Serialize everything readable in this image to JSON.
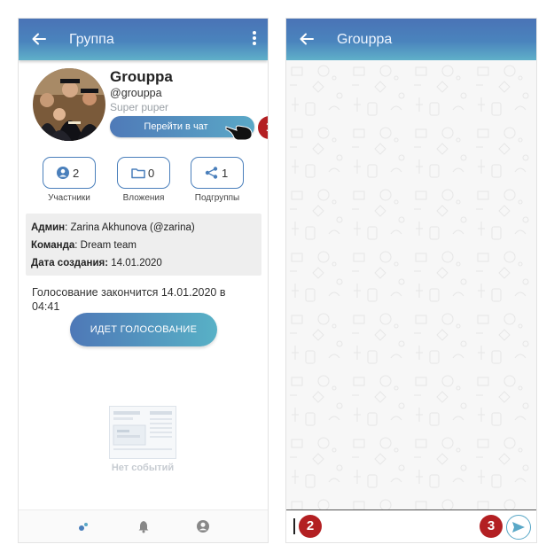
{
  "left_screen": {
    "appbar": {
      "title": "Группа",
      "back_icon": "arrow-left-icon",
      "menu_icon": "more-vertical-icon"
    },
    "group": {
      "name": "Grouppa",
      "handle": "@grouppa",
      "description": "Super puper",
      "chat_button": "Перейти в чат"
    },
    "stats": [
      {
        "icon": "user-icon",
        "count": "2",
        "label": "Участники"
      },
      {
        "icon": "folder-icon",
        "count": "0",
        "label": "Вложения"
      },
      {
        "icon": "share-icon",
        "count": "1",
        "label": "Подгруппы"
      }
    ],
    "info": {
      "admin_label": "Админ",
      "admin_value": ": Zarina Akhunova (@zarina)",
      "team_label": "Команда",
      "team_value": ": Dream team",
      "created_label": "Дата создания:",
      "created_value": " 14.01.2020"
    },
    "vote_text": "Голосование закончится 14.01.2020 в 04:41",
    "vote_button": "ИДЕТ ГОЛОСОВАНИЕ",
    "empty_text": "Нет событий",
    "bottom_nav": [
      "dots-icon",
      "bell-icon",
      "account-icon"
    ]
  },
  "right_screen": {
    "appbar": {
      "title": "Grouppa",
      "back_icon": "arrow-left-icon"
    },
    "send_icon": "send-icon"
  },
  "markers": [
    "1",
    "2",
    "3"
  ],
  "colors": {
    "accent": "#4a7fbb",
    "accent2": "#5aa8c7",
    "marker": "#b31f22"
  }
}
